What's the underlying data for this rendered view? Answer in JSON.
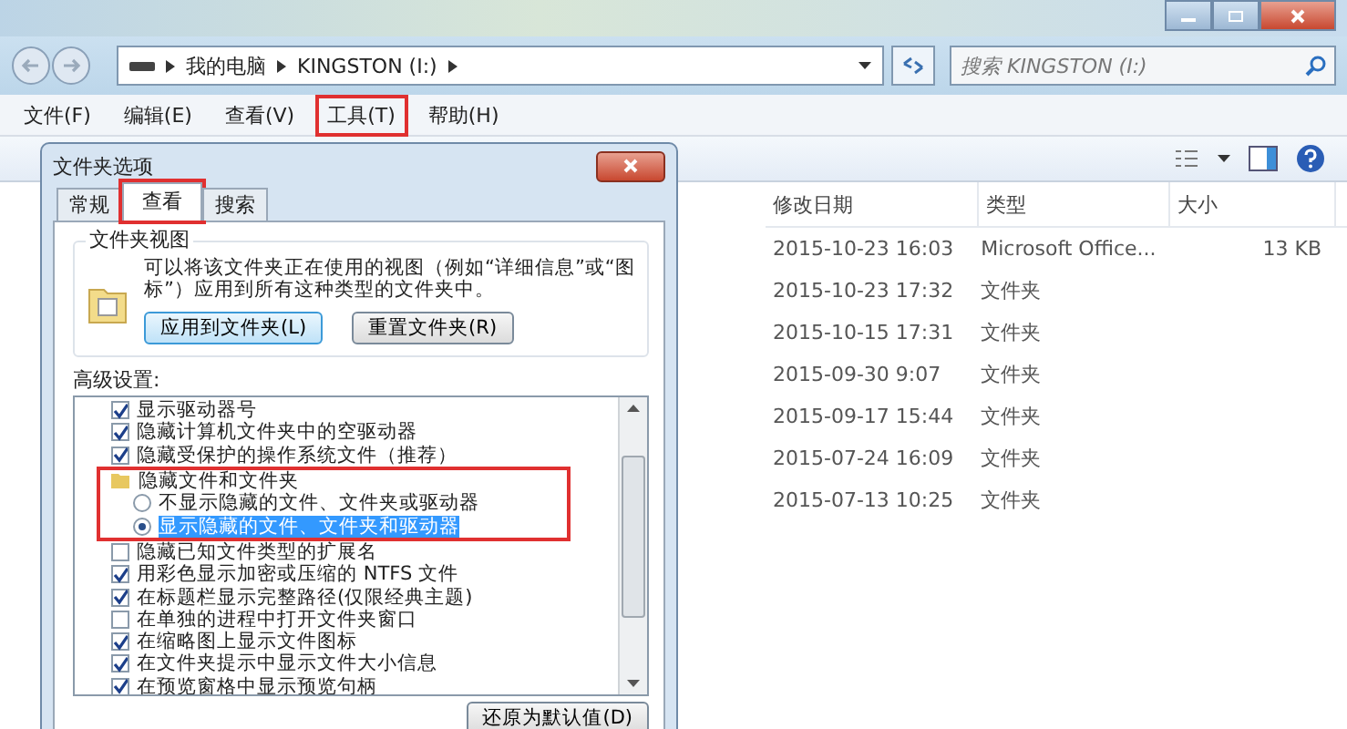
{
  "address_bar": {
    "crumbs": [
      "我的电脑",
      "KINGSTON (I:)"
    ]
  },
  "search": {
    "placeholder": "搜索 KINGSTON (I:)"
  },
  "menu": [
    {
      "label": "文件(F)",
      "highlighted": false
    },
    {
      "label": "编辑(E)",
      "highlighted": false
    },
    {
      "label": "查看(V)",
      "highlighted": false
    },
    {
      "label": "工具(T)",
      "highlighted": true
    },
    {
      "label": "帮助(H)",
      "highlighted": false
    }
  ],
  "file_list": {
    "columns": [
      "修改日期",
      "类型",
      "大小"
    ],
    "rows": [
      {
        "date": "2015-10-23 16:03",
        "type": "Microsoft Office...",
        "size": "13 KB"
      },
      {
        "date": "2015-10-23 17:32",
        "type": "文件夹",
        "size": ""
      },
      {
        "date": "2015-10-15 17:31",
        "type": "文件夹",
        "size": ""
      },
      {
        "date": "2015-09-30 9:07",
        "type": "文件夹",
        "size": ""
      },
      {
        "date": "2015-09-17 15:44",
        "type": "文件夹",
        "size": ""
      },
      {
        "date": "2015-07-24 16:09",
        "type": "文件夹",
        "size": ""
      },
      {
        "date": "2015-07-13 10:25",
        "type": "文件夹",
        "size": ""
      }
    ]
  },
  "dialog": {
    "title": "文件夹选项",
    "tabs": [
      {
        "label": "常规",
        "selected": false,
        "highlighted": false
      },
      {
        "label": "查看",
        "selected": true,
        "highlighted": true
      },
      {
        "label": "搜索",
        "selected": false,
        "highlighted": false
      }
    ],
    "folder_views": {
      "title": "文件夹视图",
      "description": "可以将该文件夹正在使用的视图（例如“详细信息”或“图标”）应用到所有这种类型的文件夹中。",
      "buttons": [
        "应用到文件夹(L)",
        "重置文件夹(R)"
      ]
    },
    "advanced_label": "高级设置:",
    "advanced": [
      {
        "kind": "checkbox",
        "label": "显示驱动器号",
        "checked": true
      },
      {
        "kind": "checkbox",
        "label": "隐藏计算机文件夹中的空驱动器",
        "checked": true
      },
      {
        "kind": "checkbox",
        "label": "隐藏受保护的操作系统文件（推荐）",
        "checked": true
      },
      {
        "kind": "folder",
        "label": "隐藏文件和文件夹",
        "highlighted": true,
        "children": [
          {
            "kind": "radio",
            "label": "不显示隐藏的文件、文件夹或驱动器",
            "selected": false
          },
          {
            "kind": "radio",
            "label": "显示隐藏的文件、文件夹和驱动器",
            "selected": true
          }
        ]
      },
      {
        "kind": "checkbox",
        "label": "隐藏已知文件类型的扩展名",
        "checked": false
      },
      {
        "kind": "checkbox",
        "label": "用彩色显示加密或压缩的 NTFS 文件",
        "checked": true
      },
      {
        "kind": "checkbox",
        "label": "在标题栏显示完整路径(仅限经典主题)",
        "checked": true
      },
      {
        "kind": "checkbox",
        "label": "在单独的进程中打开文件夹窗口",
        "checked": false
      },
      {
        "kind": "checkbox",
        "label": "在缩略图上显示文件图标",
        "checked": true
      },
      {
        "kind": "checkbox",
        "label": "在文件夹提示中显示文件大小信息",
        "checked": true
      },
      {
        "kind": "checkbox",
        "label": "在预览窗格中显示预览句柄",
        "checked": true
      }
    ],
    "restore_button": "还原为默认值(D)"
  }
}
